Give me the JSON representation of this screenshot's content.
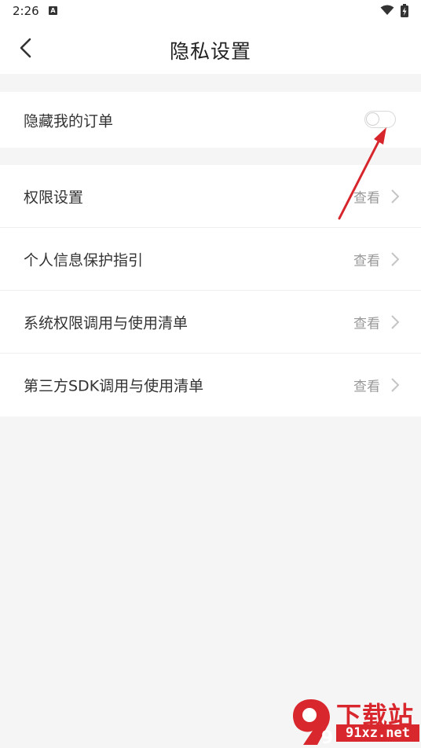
{
  "status_bar": {
    "time": "2:26",
    "notification_icon": "a-square-icon",
    "notification_letter": "A",
    "wifi_icon": "wifi-icon",
    "battery_icon": "battery-charging-icon"
  },
  "header": {
    "title": "隐私设置",
    "back_icon": "chevron-left-icon"
  },
  "toggle_section": {
    "label": "隐藏我的订单",
    "toggle_on": false
  },
  "settings": {
    "items": [
      {
        "label": "权限设置",
        "action": "查看"
      },
      {
        "label": "个人信息保护指引",
        "action": "查看"
      },
      {
        "label": "系统权限调用与使用清单",
        "action": "查看"
      },
      {
        "label": "第三方SDK调用与使用清单",
        "action": "查看"
      }
    ]
  },
  "watermark": {
    "title": "下载站",
    "domain": "91xz.net",
    "badge": "9"
  },
  "colors": {
    "annotation_arrow": "#d6262c",
    "watermark_red": "#d9272e",
    "background": "#f5f5f5"
  }
}
